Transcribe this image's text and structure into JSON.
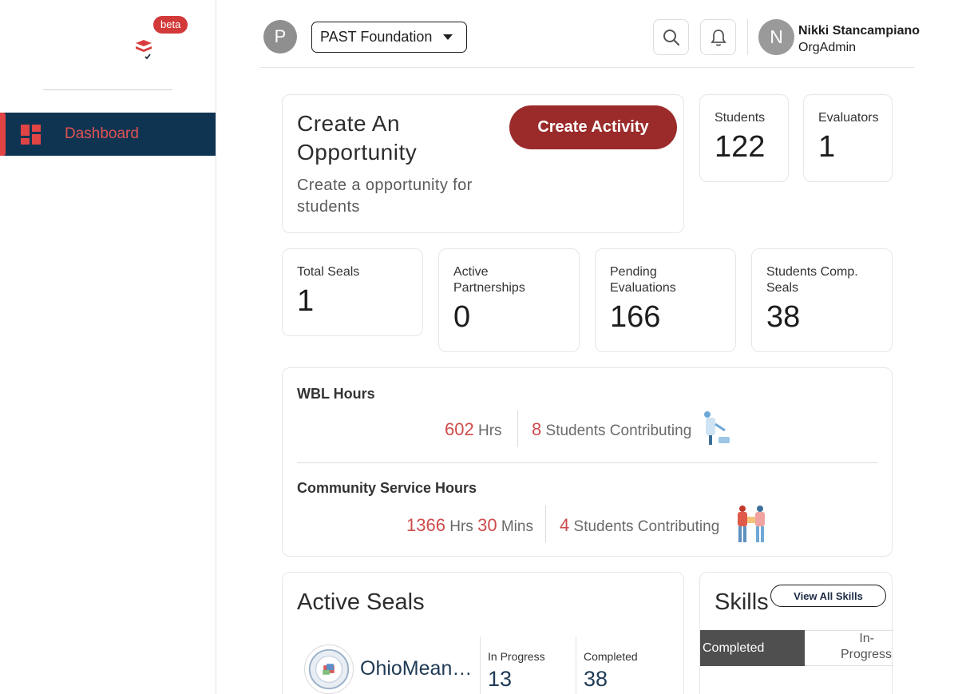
{
  "sidebar": {
    "beta_label": "beta",
    "nav_items": [
      {
        "label": "Dashboard",
        "icon": "dashboard-grid-icon",
        "active": true
      }
    ]
  },
  "header": {
    "org_avatar_letter": "P",
    "org_name": "PAST Foundation",
    "user_avatar_letter": "N",
    "user_name": "Nikki Stancampiano",
    "user_role": "OrgAdmin"
  },
  "opportunity": {
    "title_line1": "Create An",
    "title_line2": "Opportunity",
    "subtitle": "Create a opportunity for students",
    "button_label": "Create Activity"
  },
  "stats_top": [
    {
      "label": "Students",
      "value": "122"
    },
    {
      "label": "Evaluators",
      "value": "1"
    }
  ],
  "stats_row": [
    {
      "label": "Total Seals",
      "value": "1"
    },
    {
      "label": "Active Partnerships",
      "value": "0"
    },
    {
      "label": "Pending Evaluations",
      "value": "166"
    },
    {
      "label": "Students Comp. Seals",
      "value": "38"
    }
  ],
  "hours": {
    "wbl": {
      "title": "WBL Hours",
      "hours": "602",
      "hours_unit": "Hrs",
      "students": "8",
      "students_label": "Students Contributing"
    },
    "community": {
      "title": "Community Service Hours",
      "hours": "1366",
      "hours_unit": "Hrs",
      "mins": "30",
      "mins_unit": "Mins",
      "students": "4",
      "students_label": "Students Contributing"
    }
  },
  "active_seals": {
    "title": "Active Seals",
    "seal_name": "OhioMean…",
    "in_progress_label": "In Progress",
    "in_progress_value": "13",
    "completed_label": "Completed",
    "completed_value": "38"
  },
  "skills": {
    "title": "Skills",
    "view_all_label": "View All Skills",
    "tab_completed": "Completed",
    "tab_in_progress_line1": "In-",
    "tab_in_progress_line2": "Progress"
  },
  "colors": {
    "nav_bg": "#0f3452",
    "accent_red": "#cf4b4b",
    "button_red": "#9b2b2b"
  }
}
